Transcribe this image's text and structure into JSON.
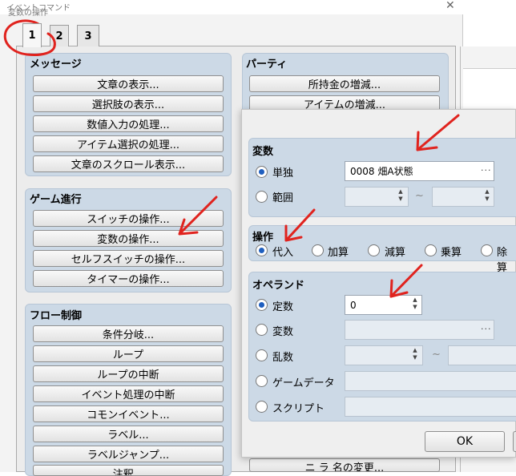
{
  "main_window": {
    "title": "イベントコマンド",
    "close_glyph": "✕",
    "tabs": [
      "1",
      "2",
      "3"
    ]
  },
  "groups": {
    "message": {
      "title": "メッセージ",
      "buttons": [
        "文章の表示...",
        "選択肢の表示...",
        "数値入力の処理...",
        "アイテム選択の処理...",
        "文章のスクロール表示..."
      ]
    },
    "game_progress": {
      "title": "ゲーム進行",
      "buttons": [
        "スイッチの操作...",
        "変数の操作...",
        "セルフスイッチの操作...",
        "タイマーの操作..."
      ]
    },
    "flow_control": {
      "title": "フロー制御",
      "buttons": [
        "条件分岐...",
        "ループ",
        "ループの中断",
        "イベント処理の中断",
        "コモンイベント...",
        "ラベル...",
        "ラベルジャンプ...",
        "注釈..."
      ]
    },
    "party": {
      "title": "パーティ",
      "buttons": [
        "所持金の増減...",
        "アイテムの増減..."
      ],
      "partial_bottom_button": "ニ ラ 名の変更..."
    }
  },
  "dialog": {
    "title": "変数の操作",
    "variable": {
      "title": "変数",
      "single_label": "単独",
      "single_value": "0008 畑A状態",
      "range_label": "範囲",
      "tilde": "~",
      "ellipsis": "···"
    },
    "operation": {
      "title": "操作",
      "options": [
        "代入",
        "加算",
        "減算",
        "乗算",
        "除算"
      ],
      "selected": "代入"
    },
    "operand": {
      "title": "オペランド",
      "constant_label": "定数",
      "constant_value": "0",
      "variable_label": "変数",
      "random_label": "乱数",
      "game_data_label": "ゲームデータ",
      "script_label": "スクリプト",
      "tilde": "~",
      "ellipsis": "···"
    },
    "ok_label": "OK"
  },
  "colors": {
    "annotation_red": "#e0231e",
    "group_fill": "#ccd9e6",
    "radio_selected": "#1f5fbf"
  }
}
